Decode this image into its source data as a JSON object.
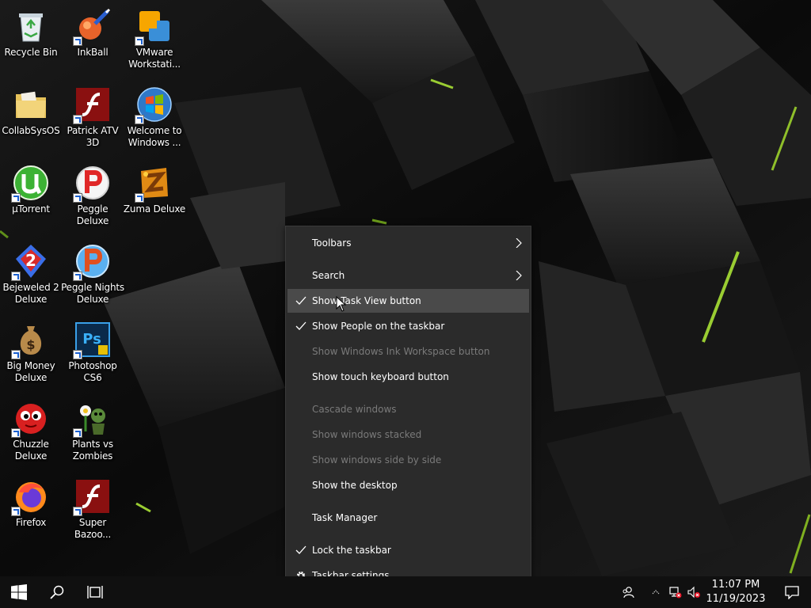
{
  "desktop": {
    "icons": [
      {
        "label": "Recycle Bin",
        "icon": "recycle-bin-icon",
        "shortcut": false
      },
      {
        "label": "InkBall",
        "icon": "inkball-icon",
        "shortcut": true
      },
      {
        "label": "VMware\nWorkstati...",
        "icon": "vmware-icon",
        "shortcut": true
      },
      {
        "label": "CollabSysOS",
        "icon": "folder-icon",
        "shortcut": false
      },
      {
        "label": "Patrick ATV\n3D",
        "icon": "flash-icon",
        "shortcut": true
      },
      {
        "label": "Welcome to\nWindows ...",
        "icon": "windows-orb-icon",
        "shortcut": true
      },
      {
        "label": "µTorrent",
        "icon": "utorrent-icon",
        "shortcut": true
      },
      {
        "label": "Peggle Deluxe",
        "icon": "peggle-icon",
        "shortcut": true
      },
      {
        "label": "Zuma Deluxe",
        "icon": "zuma-icon",
        "shortcut": true
      },
      {
        "label": "Bejeweled 2\nDeluxe",
        "icon": "bejeweled-icon",
        "shortcut": true
      },
      {
        "label": "Peggle Nights\nDeluxe",
        "icon": "peggle-nights-icon",
        "shortcut": true
      },
      {
        "label": "Big Money\nDeluxe",
        "icon": "money-bag-icon",
        "shortcut": true
      },
      {
        "label": "Photoshop\nCS6",
        "icon": "photoshop-icon",
        "shortcut": true
      },
      {
        "label": "Chuzzle\nDeluxe",
        "icon": "chuzzle-icon",
        "shortcut": true
      },
      {
        "label": "Plants vs\nZombies",
        "icon": "plants-vs-zombies-icon",
        "shortcut": true
      },
      {
        "label": "Firefox",
        "icon": "firefox-icon",
        "shortcut": true
      },
      {
        "label": "Super\nBazoo...",
        "icon": "flash-icon",
        "shortcut": true
      }
    ]
  },
  "context_menu": {
    "items": [
      {
        "label": "Toolbars",
        "submenu": true,
        "checked": false,
        "disabled": false
      },
      {
        "label": "Search",
        "submenu": true,
        "checked": false,
        "disabled": false
      },
      {
        "label": "Show Task View button",
        "checked": true,
        "disabled": false,
        "highlighted": true
      },
      {
        "label": "Show People on the taskbar",
        "checked": true,
        "disabled": false
      },
      {
        "label": "Show Windows Ink Workspace button",
        "checked": false,
        "disabled": true
      },
      {
        "label": "Show touch keyboard button",
        "checked": false,
        "disabled": false
      },
      {
        "label": "Cascade windows",
        "checked": false,
        "disabled": true
      },
      {
        "label": "Show windows stacked",
        "checked": false,
        "disabled": true
      },
      {
        "label": "Show windows side by side",
        "checked": false,
        "disabled": true
      },
      {
        "label": "Show the desktop",
        "checked": false,
        "disabled": false
      },
      {
        "label": "Task Manager",
        "checked": false,
        "disabled": false
      },
      {
        "label": "Lock the taskbar",
        "checked": true,
        "disabled": false
      },
      {
        "label": "Taskbar settings",
        "icon": "gear-icon",
        "checked": false,
        "disabled": false
      }
    ]
  },
  "taskbar": {
    "start_icon": "windows-start-icon",
    "search_icon": "search-icon",
    "taskview_icon": "task-view-icon",
    "tray": {
      "people_icon": "people-icon",
      "overflow_icon": "tray-overflow-icon",
      "network_icon": "network-error-icon",
      "volume_icon": "volume-muted-icon"
    },
    "clock": {
      "time": "11:07 PM",
      "date": "11/19/2023"
    },
    "notifications_icon": "action-center-icon"
  },
  "colors": {
    "menu_bg": "#2b2b2b",
    "menu_highlight": "#4a4a4a",
    "taskbar_bg": "#101010",
    "accent_green": "#9acd32"
  }
}
